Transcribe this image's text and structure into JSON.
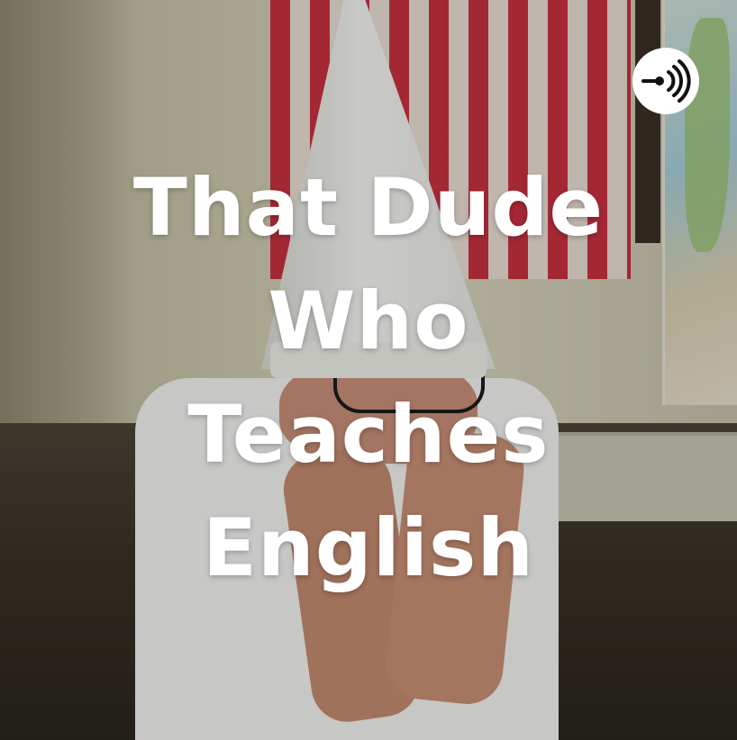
{
  "cover": {
    "title_lines": [
      "That Dude",
      "Who",
      "Teaches",
      "English"
    ]
  },
  "badge": {
    "icon": "podcast-icon",
    "color": "#ffffff"
  }
}
